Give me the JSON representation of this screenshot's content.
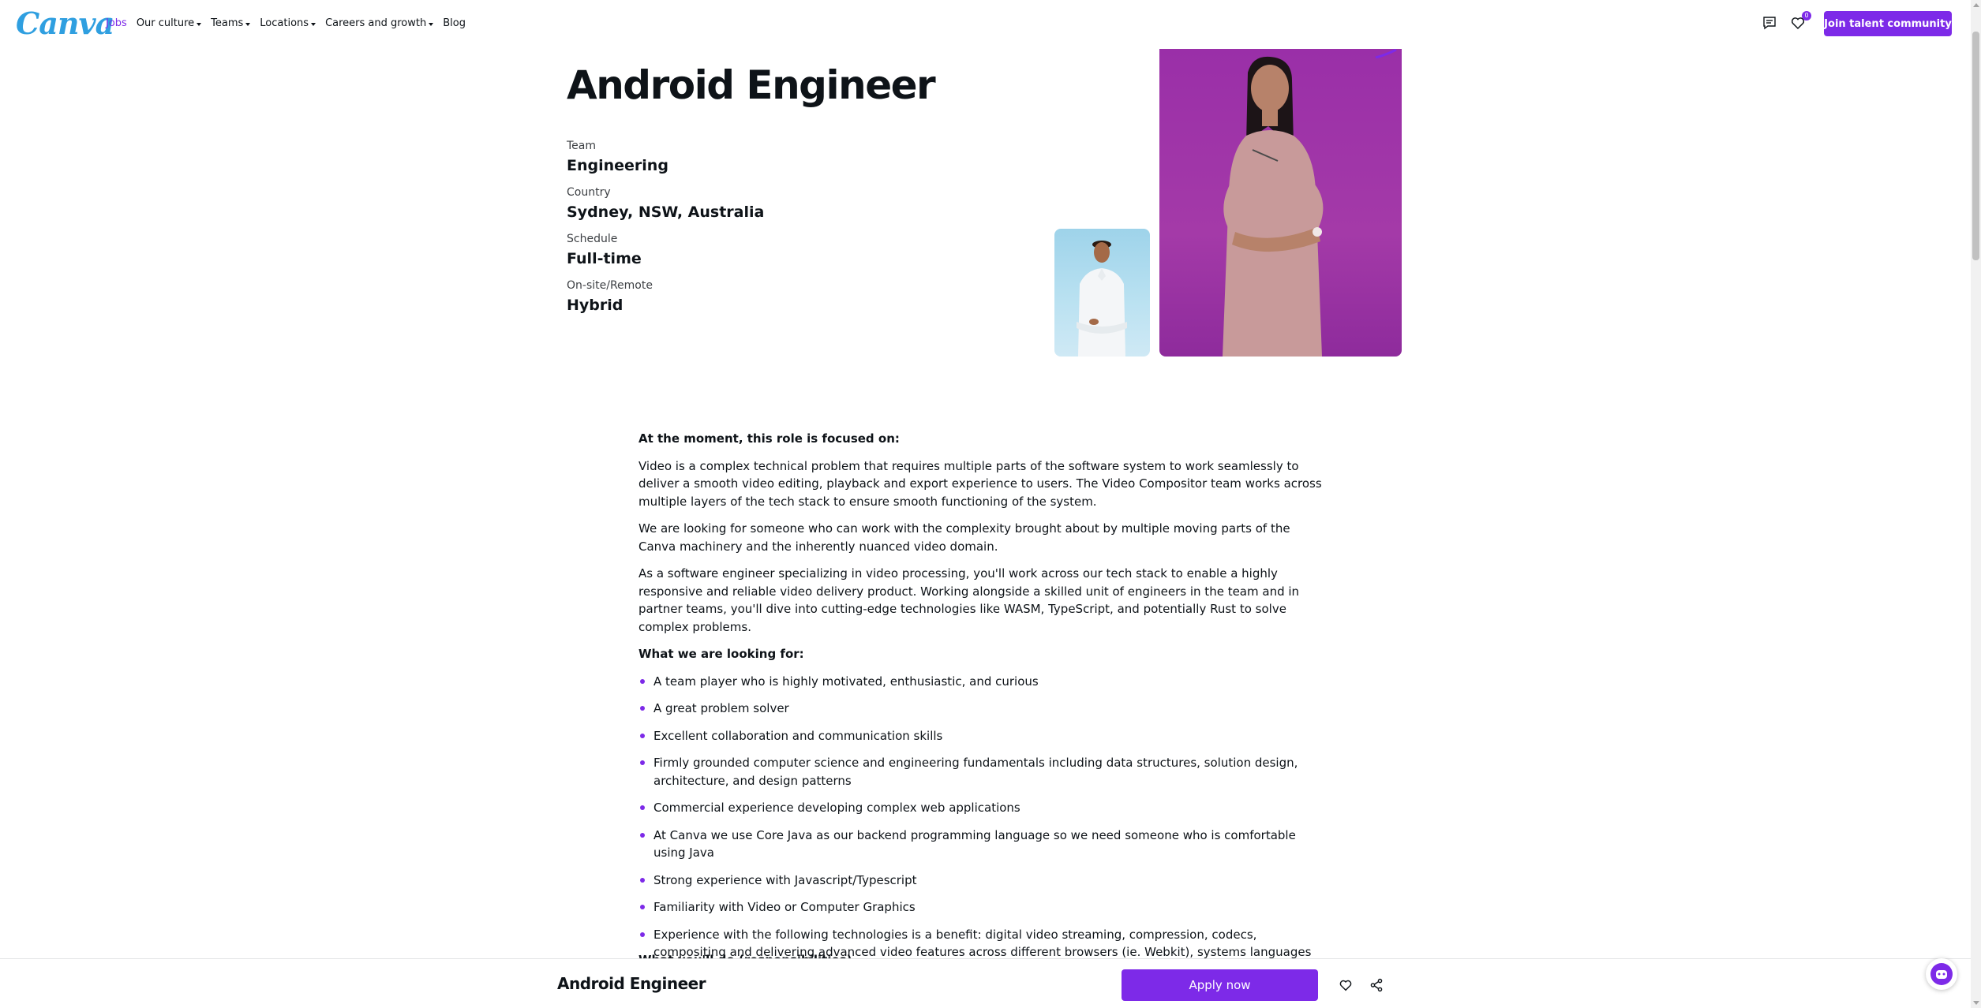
{
  "header": {
    "logo": "Canva",
    "nav": [
      {
        "label": "Jobs",
        "dropdown": false,
        "active": true
      },
      {
        "label": "Our culture",
        "dropdown": true,
        "active": false
      },
      {
        "label": "Teams",
        "dropdown": true,
        "active": false
      },
      {
        "label": "Locations",
        "dropdown": true,
        "active": false
      },
      {
        "label": "Careers and growth",
        "dropdown": true,
        "active": false
      },
      {
        "label": "Blog",
        "dropdown": false,
        "active": false
      }
    ],
    "icons": [
      "chat-icon",
      "heart-icon"
    ],
    "favorites_count": "0",
    "talent_button": "Join talent community"
  },
  "job": {
    "title": "Android Engineer",
    "meta": [
      {
        "label": "Team",
        "value": "Engineering"
      },
      {
        "label": "Country",
        "value": "Sydney, NSW, Australia"
      },
      {
        "label": "Schedule",
        "value": "Full-time"
      },
      {
        "label": "On-site/Remote",
        "value": "Hybrid"
      }
    ]
  },
  "description": {
    "focus_heading": "At the moment, this role is focused on:",
    "paragraphs": [
      "Video is a complex technical problem that requires multiple parts of the software system to work seamlessly to deliver a smooth video editing, playback and export experience to users. The Video Compositor team works across multiple layers of the tech stack to ensure smooth functioning of the system.",
      "We are looking for someone who can work with the complexity brought about by multiple moving parts of the Canva machinery and the inherently nuanced video domain.",
      "As a software engineer specializing in video processing, you'll work across our tech stack to enable a highly responsive and reliable video delivery product. Working alongside a skilled unit of engineers in the team and in partner teams, you'll dive into cutting-edge technologies like WASM, TypeScript, and potentially Rust to solve complex problems."
    ],
    "looking_heading": "What we are looking for:",
    "looking_items": [
      "A team player who is highly motivated, enthusiastic, and curious",
      "A great problem solver",
      "Excellent collaboration and communication skills",
      "Firmly grounded computer science and engineering fundamentals including data structures, solution design, architecture, and design patterns",
      "Commercial experience developing complex web applications",
      "At Canva we use Core Java as our backend programming language so we need someone who is comfortable using Java",
      "Strong experience with Javascript/Typescript",
      "Familiarity with Video or Computer Graphics",
      "Experience with the following technologies is a benefit: digital video streaming, compression, codecs, compositing and delivering advanced video features across different browsers (ie. Webkit), systems languages (eg. C/C++/Rust) and WASM"
    ],
    "next_heading_partial": "What you'll do (responsibilities)"
  },
  "footer": {
    "title": "Android Engineer",
    "apply_label": "Apply now",
    "icons": [
      "heart-icon",
      "share-icon"
    ]
  },
  "colors": {
    "accent": "#7d2ae8",
    "logo": "#2f9fe0",
    "photo_bg_large": "#a43aa8",
    "photo_bg_small": "#b9e1f1"
  }
}
